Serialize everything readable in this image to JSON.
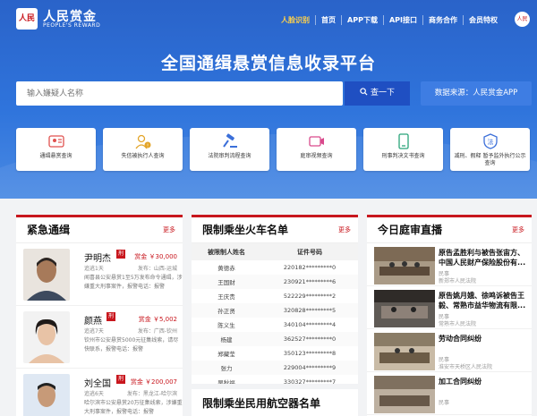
{
  "header": {
    "logo_mark": "人民",
    "logo_name": "人民赏金",
    "logo_sub": "PEOPLE'S REWARD",
    "nav": [
      "人脸识别",
      "首页",
      "APP下载",
      "API接口",
      "商务合作",
      "会员特权"
    ],
    "avatar_text": "人民"
  },
  "hero": {
    "title": "全国通缉悬赏信息收录平台",
    "search_placeholder": "输入嫌疑人名称",
    "search_button": "查一下",
    "source": "数据来源：人民赏金APP"
  },
  "cards": [
    {
      "label": "通缉悬赏查询",
      "icon": "id-card-icon"
    },
    {
      "label": "失信被执行人查询",
      "icon": "person-warning-icon"
    },
    {
      "label": "法院审判流程查询",
      "icon": "gavel-icon"
    },
    {
      "label": "庭审视频查询",
      "icon": "video-icon"
    },
    {
      "label": "刑事判决文书查询",
      "icon": "document-icon"
    },
    {
      "label": "减刑、假释 暂予监外执行公示查询",
      "icon": "shield-law-icon"
    }
  ],
  "wanted": {
    "title": "紧急通缉",
    "more": "更多",
    "items": [
      {
        "name": "尹明杰",
        "tag": "刑",
        "reward": "赏金 ￥30,000",
        "time": "追逃1天",
        "addr": "发布：山西-运城",
        "desc": "闻喜县公安悬赏1至5万发布命令通缉，涉嫌重大刑事案件，报警电话：报警"
      },
      {
        "name": "颜燕",
        "tag": "刑",
        "reward": "赏金 ￥5,002",
        "time": "追逃7天",
        "addr": "发布：广西-钦州",
        "desc": "钦州市公安悬赏5000元征集线索，请尽快联系，报警电话：报警"
      },
      {
        "name": "刘全国",
        "tag": "刑",
        "reward": "赏金 ￥200,007",
        "time": "追逃6天",
        "addr": "发布：黑龙江-哈尔滨",
        "desc": "哈尔滨市公安悬赏20万征集线索，涉嫌重大刑事案件，报警电话：报警"
      }
    ]
  },
  "train": {
    "title": "限制乘坐火车名单",
    "more": "更多",
    "headers": [
      "被限制人姓名",
      "证件号码"
    ],
    "rows": [
      [
        "黄德赤",
        "220182*********0"
      ],
      [
        "王国财",
        "230921*********6"
      ],
      [
        "王庆贵",
        "522229*********2"
      ],
      [
        "孙正贤",
        "320828*********5"
      ],
      [
        "陈义生",
        "340104*********4"
      ],
      [
        "杨建",
        "362527*********0"
      ],
      [
        "郑藏莹",
        "350123*********8"
      ],
      [
        "张力",
        "229004*********9"
      ],
      [
        "吴秋福",
        "330327*********7"
      ]
    ],
    "sub_title": "限制乘坐民用航空器名单"
  },
  "court": {
    "title": "今日庭审直播",
    "more": "更多",
    "items": [
      {
        "title": "原告孟胜利与被告张宙方、中国人民财产保险股份有...",
        "type": "民事",
        "court": "新郑市人民法院"
      },
      {
        "title": "原告姚月娥、徐鸣诉被告王毅、常熟市益华物流有限...",
        "type": "民事",
        "court": "常熟市人民法院"
      },
      {
        "title": "劳动合同纠纷",
        "type": "民事",
        "court": "淮安市天桥区人民法院"
      },
      {
        "title": "加工合同纠纷",
        "type": "民事",
        "court": ""
      }
    ]
  },
  "colors": {
    "brand_red": "#c8161d",
    "hero_blue": "#2f74dc",
    "button_blue": "#1f4fc2"
  }
}
